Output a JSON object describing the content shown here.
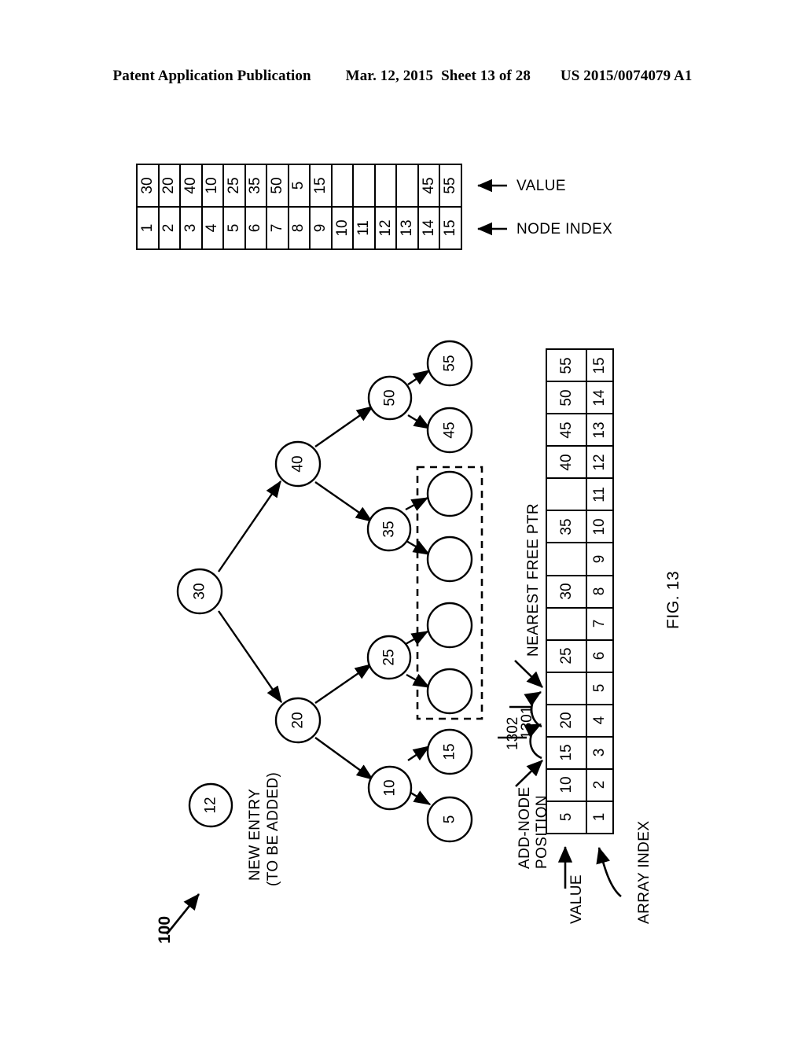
{
  "header": {
    "publication": "Patent Application Publication",
    "date": "Mar. 12, 2015",
    "sheet": "Sheet 13 of 28",
    "patent_number": "US 2015/0074079 A1"
  },
  "figure": {
    "label": "FIG. 13",
    "reference_numeral": "100"
  },
  "node_table": {
    "value_label": "VALUE",
    "node_index_label": "NODE INDEX",
    "values": [
      "30",
      "20",
      "40",
      "10",
      "25",
      "35",
      "50",
      "5",
      "15",
      "",
      "",
      "",
      "",
      "45",
      "55"
    ],
    "node_indices": [
      "1",
      "2",
      "3",
      "4",
      "5",
      "6",
      "7",
      "8",
      "9",
      "10",
      "11",
      "12",
      "13",
      "14",
      "15"
    ]
  },
  "tree": {
    "root": "30",
    "nodes": [
      {
        "id": "n30",
        "label": "30"
      },
      {
        "id": "n40",
        "label": "40"
      },
      {
        "id": "n20",
        "label": "20"
      },
      {
        "id": "n50",
        "label": "50"
      },
      {
        "id": "n35",
        "label": "35"
      },
      {
        "id": "n25",
        "label": "25"
      },
      {
        "id": "n10",
        "label": "10"
      },
      {
        "id": "n55",
        "label": "55"
      },
      {
        "id": "n45",
        "label": "45"
      },
      {
        "id": "n15",
        "label": "15"
      },
      {
        "id": "n5",
        "label": "5"
      },
      {
        "id": "e1",
        "label": ""
      },
      {
        "id": "e2",
        "label": ""
      },
      {
        "id": "e3",
        "label": ""
      },
      {
        "id": "e4",
        "label": ""
      }
    ],
    "edges": [
      [
        "n30",
        "n40"
      ],
      [
        "n30",
        "n20"
      ],
      [
        "n40",
        "n50"
      ],
      [
        "n40",
        "n35"
      ],
      [
        "n20",
        "n25"
      ],
      [
        "n20",
        "n10"
      ],
      [
        "n50",
        "n55"
      ],
      [
        "n50",
        "n45"
      ],
      [
        "n35",
        "e1"
      ],
      [
        "n35",
        "e2"
      ],
      [
        "n25",
        "e3"
      ],
      [
        "n25",
        "e4"
      ],
      [
        "n10",
        "n15"
      ],
      [
        "n10",
        "n5"
      ]
    ],
    "new_entry": {
      "label": "12",
      "caption_line1": "NEW ENTRY",
      "caption_line2": "(TO BE ADDED)"
    },
    "dashed_group_ref": "1302"
  },
  "array_table": {
    "value_label": "VALUE",
    "array_index_label": "ARRAY INDEX",
    "values": [
      "5",
      "10",
      "15",
      "20",
      "",
      "25",
      "",
      "30",
      "",
      "35",
      "",
      "40",
      "45",
      "50",
      "55"
    ],
    "indices": [
      "1",
      "2",
      "3",
      "4",
      "5",
      "6",
      "7",
      "8",
      "9",
      "10",
      "11",
      "12",
      "13",
      "14",
      "15"
    ],
    "annotations": {
      "add_node_position_line1": "ADD-NODE",
      "add_node_position_line2": "POSITION",
      "nearest_free_ptr": "NEAREST FREE PTR",
      "pointer_1301": "1301",
      "pointer_1302": "1302"
    }
  },
  "colors": {
    "ink": "#000000",
    "paper": "#ffffff"
  }
}
